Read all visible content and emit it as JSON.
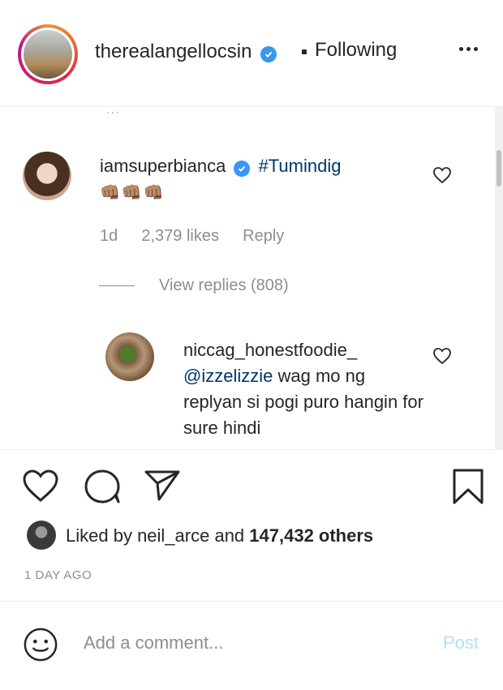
{
  "header": {
    "username": "therealangellocsin",
    "verified": true,
    "separator": "•",
    "follow_status": "Following",
    "more_icon": "more-horizontal-icon"
  },
  "comments": [
    {
      "username": "iamsuperbianca",
      "verified": true,
      "text_hashtag": "#Tumindig",
      "emoji": "👊🏽👊🏽👊🏽",
      "time": "1d",
      "likes": "2,379 likes",
      "reply_label": "Reply",
      "view_replies": "View replies (808)"
    }
  ],
  "reply": {
    "username": "niccag_honestfoodie_",
    "mention": "@izzelizzie",
    "text": " wag mo ng replyan si pogi puro hangin for sure hindi"
  },
  "actions": {
    "like_icon": "heart-icon",
    "comment_icon": "comment-icon",
    "share_icon": "paper-plane-icon",
    "save_icon": "bookmark-icon"
  },
  "likes": {
    "prefix": "Liked by ",
    "user": "neil_arce",
    "middle": " and ",
    "count": "147,432 others"
  },
  "timestamp": "1 DAY AGO",
  "comment_box": {
    "placeholder": "Add a comment...",
    "post_label": "Post"
  },
  "colors": {
    "verified_blue": "#3897f0",
    "hashtag_blue": "#00376b",
    "post_disabled": "#b2dffc",
    "secondary_text": "#8e8e8e"
  }
}
